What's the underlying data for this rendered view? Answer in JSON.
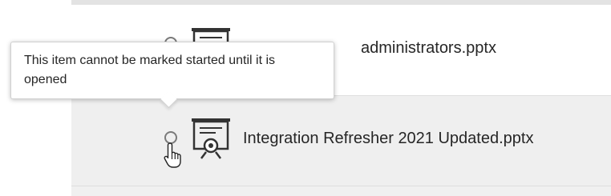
{
  "rows": [
    {
      "title": "administrators.pptx",
      "file_icon": "presentation-icon",
      "status_icon": "not-started-circle-icon"
    },
    {
      "title": "Integration Refresher 2021 Updated.pptx",
      "file_icon": "presentation-icon",
      "status_icon": "not-started-circle-icon"
    }
  ],
  "tooltip": {
    "text": "This item cannot be marked started until it is opened"
  },
  "cursor": "hand-pointer-icon",
  "colors": {
    "row_highlight": "#efefef",
    "text": "#262626",
    "status_circle": "#7a7a7a"
  }
}
